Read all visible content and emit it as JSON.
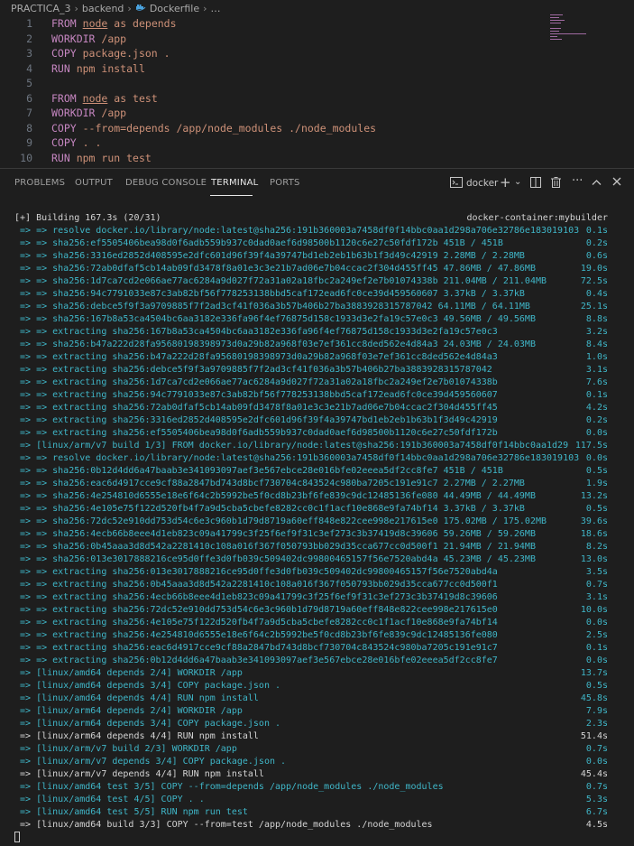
{
  "breadcrumb": {
    "items": [
      "PRACTICA_3",
      "backend",
      "Dockerfile",
      "…"
    ]
  },
  "editor": {
    "lines": [
      {
        "n": "1",
        "kw": "FROM",
        "img": "node",
        "rest": " as ",
        "arg": "depends"
      },
      {
        "n": "2",
        "kw": "WORKDIR",
        "arg": " /app"
      },
      {
        "n": "3",
        "kw": "COPY",
        "arg": " package.json ."
      },
      {
        "n": "4",
        "kw": "RUN",
        "arg": " npm install"
      },
      {
        "n": "5"
      },
      {
        "n": "6",
        "kw": "FROM",
        "img": "node",
        "rest": " as ",
        "arg": "test"
      },
      {
        "n": "7",
        "kw": "WORKDIR",
        "arg": " /app"
      },
      {
        "n": "8",
        "kw": "COPY",
        "arg": " --from=depends /app/node_modules ./node_modules"
      },
      {
        "n": "9",
        "kw": "COPY",
        "arg": " . ."
      },
      {
        "n": "10",
        "kw": "RUN",
        "arg": " npm run test"
      }
    ]
  },
  "panel": {
    "tabs": [
      "PROBLEMS",
      "OUTPUT",
      "DEBUG CONSOLE",
      "TERMINAL",
      "PORTS"
    ],
    "active_tab": "TERMINAL",
    "terminal_name": "docker"
  },
  "terminal": {
    "header_left": "[+] Building 167.3s (20/31)",
    "header_right": "docker-container:mybuilder",
    "lines": [
      {
        "t": " => => resolve docker.io/library/node:latest@sha256:191b360003a7458df0f14bbc0aa1d298a706e32786e183019103",
        "r": "0.1s",
        "c": "cyan"
      },
      {
        "t": " => => sha256:ef5505406bea98d0f6adb559b937c0dad0aef6d98500b1120c6e27c50fdf172b 451B / 451B",
        "r": "0.2s",
        "c": "cyan"
      },
      {
        "t": " => => sha256:3316ed2852d408595e2dfc601d96f39f4a39747bd1eb2eb1b63b1f3d49c42919 2.28MB / 2.28MB",
        "r": "0.6s",
        "c": "cyan"
      },
      {
        "t": " => => sha256:72ab0dfaf5cb14ab09fd3478f8a01e3c3e21b7ad06e7b04ccac2f304d455ff45 47.86MB / 47.86MB",
        "r": "19.0s",
        "c": "cyan"
      },
      {
        "t": " => => sha256:1d7ca7cd2e066ae77ac6284a9d027f72a31a02a18fbc2a249ef2e7b01074338b 211.04MB / 211.04MB",
        "r": "72.5s",
        "c": "cyan"
      },
      {
        "t": " => => sha256:94c7791033e87c3ab82bf56f778253138bbd5caf172ead6fc0ce39d459560607 3.37kB / 3.37kB",
        "r": "0.4s",
        "c": "cyan"
      },
      {
        "t": " => => sha256:debce5f9f3a9709885f7f2ad3cf41f036a3b57b406b27ba3883928315787042 64.11MB / 64.11MB",
        "r": "25.1s",
        "c": "cyan"
      },
      {
        "t": " => => sha256:167b8a53ca4504bc6aa3182e336fa96f4ef76875d158c1933d3e2fa19c57e0c3 49.56MB / 49.56MB",
        "r": "8.8s",
        "c": "cyan"
      },
      {
        "t": " => => extracting sha256:167b8a53ca4504bc6aa3182e336fa96f4ef76875d158c1933d3e2fa19c57e0c3",
        "r": "3.2s",
        "c": "cyan"
      },
      {
        "t": " => => sha256:b47a222d28fa95680198398973d0a29b82a968f03e7ef361cc8ded562e4d84a3 24.03MB / 24.03MB",
        "r": "8.4s",
        "c": "cyan"
      },
      {
        "t": " => => extracting sha256:b47a222d28fa95680198398973d0a29b82a968f03e7ef361cc8ded562e4d84a3",
        "r": "1.0s",
        "c": "cyan"
      },
      {
        "t": " => => extracting sha256:debce5f9f3a9709885f7f2ad3cf41f036a3b57b406b27ba3883928315787042",
        "r": "3.1s",
        "c": "cyan"
      },
      {
        "t": " => => extracting sha256:1d7ca7cd2e066ae77ac6284a9d027f72a31a02a18fbc2a249ef2e7b01074338b",
        "r": "7.6s",
        "c": "cyan"
      },
      {
        "t": " => => extracting sha256:94c7791033e87c3ab82bf56f778253138bbd5caf172ead6fc0ce39d459560607",
        "r": "0.1s",
        "c": "cyan"
      },
      {
        "t": " => => extracting sha256:72ab0dfaf5cb14ab09fd3478f8a01e3c3e21b7ad06e7b04ccac2f304d455ff45",
        "r": "4.2s",
        "c": "cyan"
      },
      {
        "t": " => => extracting sha256:3316ed2852d408595e2dfc601d96f39f4a39747bd1eb2eb1b63b1f3d49c42919",
        "r": "0.2s",
        "c": "cyan"
      },
      {
        "t": " => => extracting sha256:ef5505406bea98d0f6adb559b937c0dad0aef6d98500b1120c6e27c50fdf172b",
        "r": "0.0s",
        "c": "cyan"
      },
      {
        "t": " => [linux/arm/v7 build 1/3] FROM docker.io/library/node:latest@sha256:191b360003a7458df0f14bbc0aa1d29",
        "r": "117.5s",
        "c": "cyan"
      },
      {
        "t": " => => resolve docker.io/library/node:latest@sha256:191b360003a7458df0f14bbc0aa1d298a706e32786e183019103",
        "r": "0.0s",
        "c": "cyan"
      },
      {
        "t": " => => sha256:0b12d4dd6a47baab3e341093097aef3e567ebce28e016bfe02eeea5df2cc8fe7 451B / 451B",
        "r": "0.5s",
        "c": "cyan"
      },
      {
        "t": " => => sha256:eac6d4917cce9cf88a2847bd743d8bcf730704c843524c980ba7205c191e91c7 2.27MB / 2.27MB",
        "r": "1.9s",
        "c": "cyan"
      },
      {
        "t": " => => sha256:4e254810d6555e18e6f64c2b5992be5f0cd8b23bf6fe839c9dc12485136fe080 44.49MB / 44.49MB",
        "r": "13.2s",
        "c": "cyan"
      },
      {
        "t": " => => sha256:4e105e75f122d520fb4f7a9d5cba5cbefe8282cc0c1f1acf10e868e9fa74bf14 3.37kB / 3.37kB",
        "r": "0.5s",
        "c": "cyan"
      },
      {
        "t": " => => sha256:72dc52e910dd753d54c6e3c960b1d79d8719a60eff848e822cee998e217615e0 175.02MB / 175.02MB",
        "r": "39.6s",
        "c": "cyan"
      },
      {
        "t": " => => sha256:4ecb66b8eee4d1eb823c09a41799c3f25f6ef9f31c3ef273c3b37419d8c39606 59.26MB / 59.26MB",
        "r": "18.6s",
        "c": "cyan"
      },
      {
        "t": " => => sha256:0b45aaa3d8d542a2281410c108a016f367f050793bb029d35cca677cc0d500f1 21.94MB / 21.94MB",
        "r": "8.2s",
        "c": "cyan"
      },
      {
        "t": " => => sha256:013e3017888216ce95d0ffe3d0fb039c509402dc99800465157f56e7520abd4a 45.23MB / 45.23MB",
        "r": "13.0s",
        "c": "cyan"
      },
      {
        "t": " => => extracting sha256:013e3017888216ce95d0ffe3d0fb039c509402dc99800465157f56e7520abd4a",
        "r": "3.5s",
        "c": "cyan"
      },
      {
        "t": " => => extracting sha256:0b45aaa3d8d542a2281410c108a016f367f050793bb029d35cca677cc0d500f1",
        "r": "0.7s",
        "c": "cyan"
      },
      {
        "t": " => => extracting sha256:4ecb66b8eee4d1eb823c09a41799c3f25f6ef9f31c3ef273c3b37419d8c39606",
        "r": "3.1s",
        "c": "cyan"
      },
      {
        "t": " => => extracting sha256:72dc52e910dd753d54c6e3c960b1d79d8719a60eff848e822cee998e217615e0",
        "r": "10.0s",
        "c": "cyan"
      },
      {
        "t": " => => extracting sha256:4e105e75f122d520fb4f7a9d5cba5cbefe8282cc0c1f1acf10e868e9fa74bf14",
        "r": "0.0s",
        "c": "cyan"
      },
      {
        "t": " => => extracting sha256:4e254810d6555e18e6f64c2b5992be5f0cd8b23bf6fe839c9dc12485136fe080",
        "r": "2.5s",
        "c": "cyan"
      },
      {
        "t": " => => extracting sha256:eac6d4917cce9cf88a2847bd743d8bcf730704c843524c980ba7205c191e91c7",
        "r": "0.1s",
        "c": "cyan"
      },
      {
        "t": " => => extracting sha256:0b12d4dd6a47baab3e341093097aef3e567ebce28e016bfe02eeea5df2cc8fe7",
        "r": "0.0s",
        "c": "cyan"
      },
      {
        "t": " => [linux/amd64 depends 2/4] WORKDIR /app",
        "r": "13.7s",
        "c": "cyan"
      },
      {
        "t": " => [linux/amd64 depends 3/4] COPY package.json .",
        "r": "0.5s",
        "c": "cyan"
      },
      {
        "t": " => [linux/amd64 depends 4/4] RUN npm install",
        "r": "45.8s",
        "c": "cyan"
      },
      {
        "t": " => [linux/arm64 depends 2/4] WORKDIR /app",
        "r": "7.9s",
        "c": "cyan"
      },
      {
        "t": " => [linux/arm64 depends 3/4] COPY package.json .",
        "r": "2.3s",
        "c": "cyan"
      },
      {
        "t": " => [linux/arm64 depends 4/4] RUN npm install",
        "r": "51.4s",
        "c": "white"
      },
      {
        "t": " => [linux/arm/v7 build 2/3] WORKDIR /app",
        "r": "0.7s",
        "c": "cyan"
      },
      {
        "t": " => [linux/arm/v7 depends 3/4] COPY package.json .",
        "r": "0.0s",
        "c": "cyan"
      },
      {
        "t": " => [linux/arm/v7 depends 4/4] RUN npm install",
        "r": "45.4s",
        "c": "white"
      },
      {
        "t": " => [linux/amd64 test 3/5] COPY --from=depends /app/node_modules ./node_modules",
        "r": "0.7s",
        "c": "cyan"
      },
      {
        "t": " => [linux/amd64 test 4/5] COPY . .",
        "r": "5.3s",
        "c": "cyan"
      },
      {
        "t": " => [linux/amd64 test 5/5] RUN npm run test",
        "r": "6.7s",
        "c": "cyan"
      },
      {
        "t": " => [linux/amd64 build 3/3] COPY --from=test /app/node_modules ./node_modules",
        "r": "4.5s",
        "c": "white"
      }
    ]
  },
  "colors": {
    "background": "#1e1e1e",
    "keyword": "#c586c0",
    "string": "#ce9178",
    "terminal_cyan": "#3fb6c8",
    "terminal_white": "#d4d4d4"
  },
  "icons": [
    "docker-icon",
    "terminal-icon",
    "plus-icon",
    "chevron-down-icon",
    "split-icon",
    "trash-icon",
    "more-icon",
    "chevron-up-icon",
    "close-icon"
  ]
}
